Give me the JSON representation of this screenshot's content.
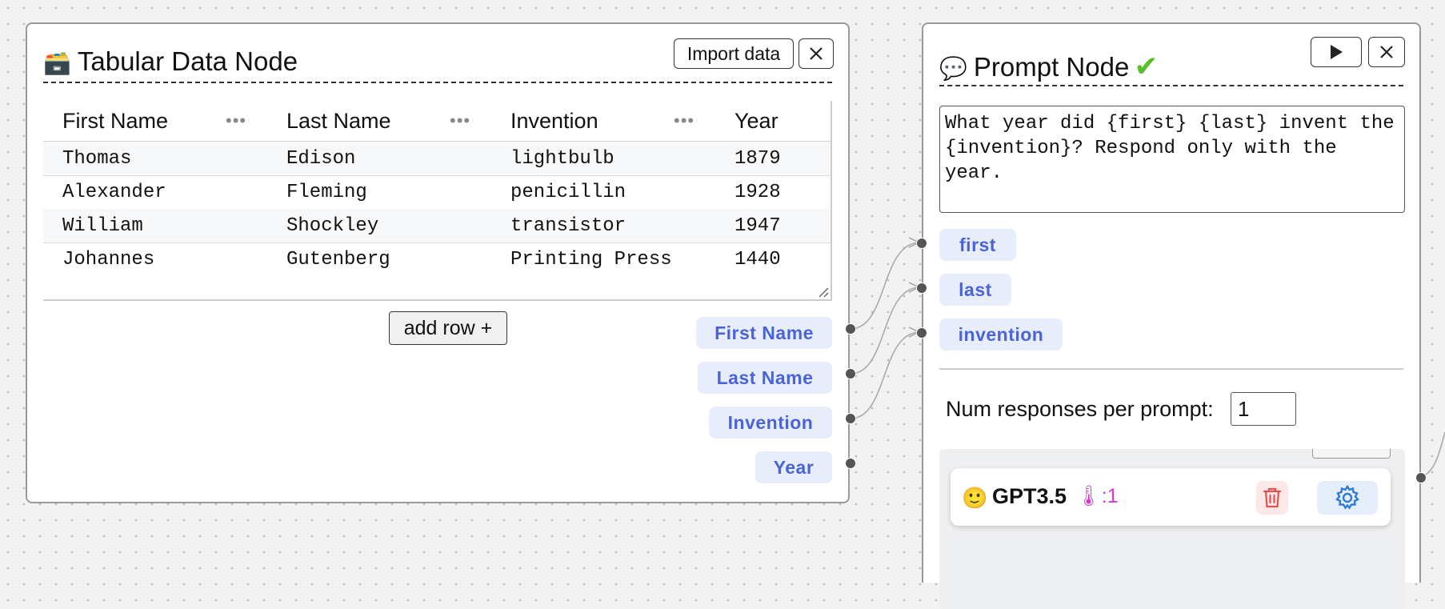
{
  "tabular_node": {
    "title": "Tabular Data Node",
    "icon": "file-box-icon",
    "import_label": "Import data",
    "columns": [
      "First Name",
      "Last Name",
      "Invention",
      "Year"
    ],
    "column_menu_glyph": "•••",
    "rows": [
      [
        "Thomas",
        "Edison",
        "lightbulb",
        "1879"
      ],
      [
        "Alexander",
        "Fleming",
        "penicillin",
        "1928"
      ],
      [
        "William",
        "Shockley",
        "transistor",
        "1947"
      ],
      [
        "Johannes",
        "Gutenberg",
        "Printing Press",
        "1440"
      ]
    ],
    "add_row_label": "add row +",
    "outputs": [
      "First Name",
      "Last Name",
      "Invention",
      "Year"
    ]
  },
  "prompt_node": {
    "title": "Prompt Node",
    "icon": "speech-bubble-icon",
    "status_icon": "check-icon",
    "status_glyph": "✔",
    "prompt": "What year did {first} {last} invent the {invention}? Respond only with the year.",
    "inputs": [
      "first",
      "last",
      "invention"
    ],
    "num_responses_label": "Num responses per prompt:",
    "num_responses_value": "1",
    "model": {
      "emoji": "🙂",
      "name": "GPT3.5",
      "temperature_glyph": "🌡",
      "temperature": ":1"
    }
  },
  "colors": {
    "pill_bg": "#e8edfb",
    "pill_text": "#4a64d8",
    "check": "#5bbf2a",
    "temperature": "#d23bd0",
    "delete": "#e05252",
    "settings": "#2f7ad8"
  }
}
